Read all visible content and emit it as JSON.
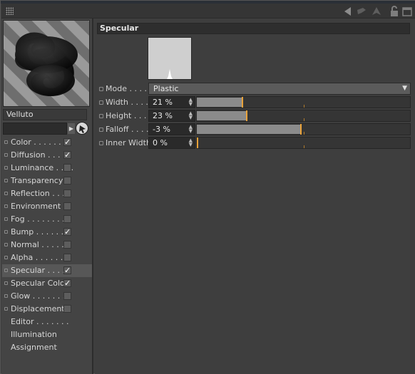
{
  "window": {
    "toolbar_icons": [
      "back-arrow-icon",
      "forward-arrow-icon",
      "up-arrow-icon",
      "lock-icon",
      "new-panel-icon"
    ]
  },
  "material": {
    "name": "Velluto",
    "preview_icon": "material-preview-sphere-icon"
  },
  "channels": [
    {
      "label": "Color . . . . . . . .",
      "checked": true
    },
    {
      "label": "Diffusion . . . . .",
      "checked": true
    },
    {
      "label": "Luminance . . . .",
      "checked": false
    },
    {
      "label": "Transparency",
      "checked": false
    },
    {
      "label": "Reflection . . . .",
      "checked": false
    },
    {
      "label": "Environment",
      "checked": false
    },
    {
      "label": "Fog . . . . . . . . .",
      "checked": false
    },
    {
      "label": "Bump . . . . . . .",
      "checked": true
    },
    {
      "label": "Normal . . . . . .",
      "checked": false
    },
    {
      "label": "Alpha . . . . . . .",
      "checked": false
    },
    {
      "label": "Specular . . . .",
      "checked": true,
      "selected": true
    },
    {
      "label": "Specular Color",
      "checked": true
    },
    {
      "label": "Glow . . . . . . . .",
      "checked": false
    },
    {
      "label": "Displacement",
      "checked": false
    }
  ],
  "extra_items": [
    {
      "label": "Editor . . . . . . ."
    },
    {
      "label": "Illumination"
    },
    {
      "label": "Assignment"
    }
  ],
  "specular": {
    "title": "Specular",
    "mode_label": "Mode . . . .",
    "mode_value": "Plastic",
    "params": [
      {
        "label": "Width . . . .",
        "value": "21 %",
        "fraction": 0.21
      },
      {
        "label": "Height . . .",
        "value": "23 %",
        "fraction": 0.23
      },
      {
        "label": "Falloff . . . .",
        "value": "-3 %",
        "fraction": 0.485
      },
      {
        "label": "Inner Width",
        "value": "0 %",
        "fraction": 0.0
      }
    ]
  },
  "colors": {
    "slider_knob": "#e9a23a",
    "accent_tick": "#b07a2a"
  }
}
